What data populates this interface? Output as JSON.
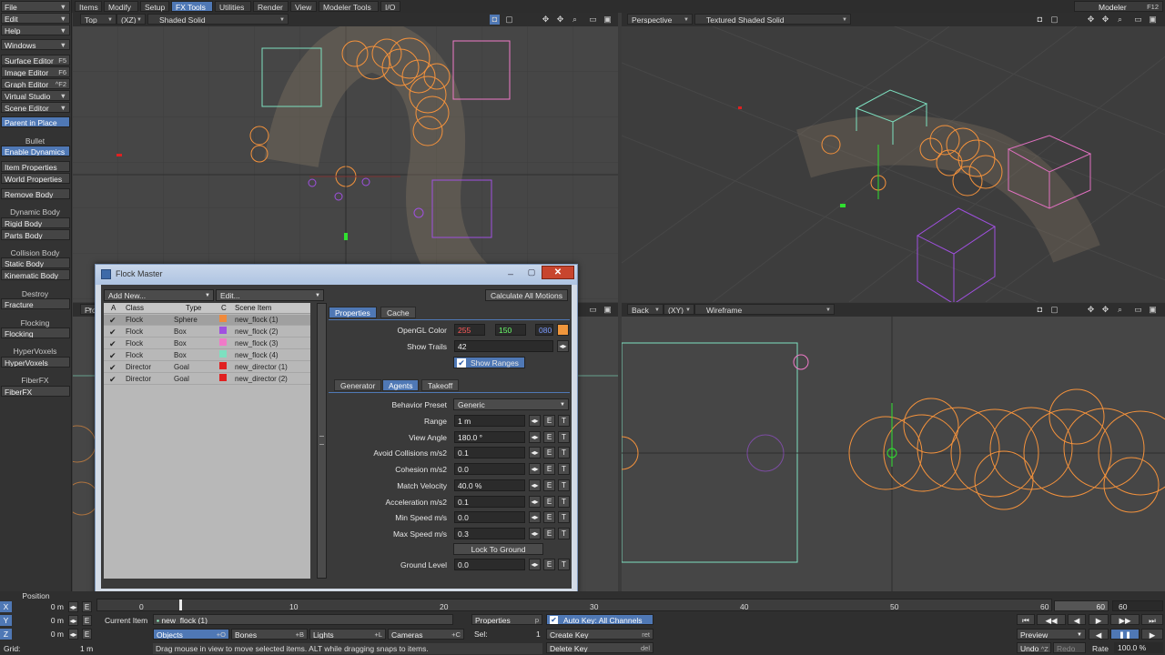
{
  "menu": {
    "left_dropdowns": [
      "File",
      "Edit",
      "Help"
    ],
    "tabs": [
      "Items",
      "Modify",
      "Setup",
      "FX Tools",
      "Utilities",
      "Render",
      "View",
      "Modeler Tools",
      "I/O"
    ],
    "active_tab": "FX Tools",
    "modeler": "Modeler",
    "modeler_key": "F12"
  },
  "sidebar": {
    "windows": "Windows",
    "editors": [
      {
        "label": "Surface Editor",
        "key": "F5"
      },
      {
        "label": "Image Editor",
        "key": "F6"
      },
      {
        "label": "Graph Editor",
        "key": "^F2"
      },
      {
        "label": "Virtual Studio",
        "key": ""
      },
      {
        "label": "Scene Editor",
        "key": ""
      }
    ],
    "parent_in_place": "Parent in Place",
    "bullet": "Bullet",
    "enable_dynamics": "Enable Dynamics",
    "item_properties": "Item Properties",
    "world_properties": "World Properties",
    "remove_body": "Remove Body",
    "dynamic_body": "Dynamic Body",
    "rigid_body": "Rigid Body",
    "parts_body": "Parts Body",
    "collision_body": "Collision Body",
    "static_body": "Static Body",
    "kinematic_body": "Kinematic Body",
    "destroy": "Destroy",
    "fracture": "Fracture",
    "flocking_head": "Flocking",
    "flocking": "Flocking",
    "hypervoxels_head": "HyperVoxels",
    "hypervoxels": "HyperVoxels",
    "fiberfx_head": "FiberFX",
    "fiberfx": "FiberFX",
    "position": "Position"
  },
  "viewports": {
    "top": {
      "view": "Top",
      "axis": "(XZ)",
      "mode": "Shaded Solid"
    },
    "persp": {
      "view": "Perspective",
      "mode": "Textured Shaded Solid"
    },
    "back": {
      "view": "Back",
      "axis": "(XY)",
      "mode": "Wireframe"
    },
    "front_stub": "Fro"
  },
  "dialog": {
    "title": "Flock Master",
    "add_new": "Add New...",
    "edit": "Edit...",
    "calculate": "Calculate All Motions",
    "columns": [
      "A",
      "Class",
      "Type",
      "C",
      "Scene Item"
    ],
    "rows": [
      {
        "cls": "Flock",
        "type": "Sphere",
        "color": "#f08a3c",
        "item": "new_flock (1)"
      },
      {
        "cls": "Flock",
        "type": "Box",
        "color": "#a050e0",
        "item": "new_flock (2)"
      },
      {
        "cls": "Flock",
        "type": "Box",
        "color": "#f07ac8",
        "item": "new_flock (3)"
      },
      {
        "cls": "Flock",
        "type": "Box",
        "color": "#7de0c0",
        "item": "new_flock (4)"
      },
      {
        "cls": "Director",
        "type": "Goal",
        "color": "#e02020",
        "item": "new_director (1)"
      },
      {
        "cls": "Director",
        "type": "Goal",
        "color": "#e02020",
        "item": "new_director (2)"
      }
    ],
    "tabs_top": [
      "Properties",
      "Cache"
    ],
    "opengl_color_label": "OpenGL Color",
    "opengl_r": "255",
    "opengl_g": "150",
    "opengl_b": "080",
    "opengl_swatch": "#f0963c",
    "show_trails_label": "Show Trails",
    "show_trails": "42",
    "show_ranges": "Show Ranges",
    "tabs_sub": [
      "Generator",
      "Agents",
      "Takeoff"
    ],
    "behavior_preset_label": "Behavior Preset",
    "behavior_preset": "Generic",
    "fields": [
      {
        "label": "Range",
        "value": "1 m"
      },
      {
        "label": "View Angle",
        "value": "180.0 °"
      },
      {
        "label": "Avoid Collisions m/s2",
        "value": "0.1"
      },
      {
        "label": "Cohesion m/s2",
        "value": "0.0"
      },
      {
        "label": "Match Velocity",
        "value": "40.0 %"
      },
      {
        "label": "Acceleration m/s2",
        "value": "0.1"
      },
      {
        "label": "Min Speed m/s",
        "value": "0.0"
      },
      {
        "label": "Max Speed m/s",
        "value": "0.3"
      }
    ],
    "lock_to_ground": "Lock To Ground",
    "ground_level_label": "Ground Level",
    "ground_level": "0.0",
    "e": "E",
    "t": "T"
  },
  "bottom": {
    "axes": [
      {
        "axis": "X",
        "value": "0 m"
      },
      {
        "axis": "Y",
        "value": "0 m"
      },
      {
        "axis": "Z",
        "value": "0 m"
      }
    ],
    "grid_label": "Grid:",
    "grid_value": "1 m",
    "timeline_ticks": [
      "0",
      "10",
      "20",
      "30",
      "40",
      "50",
      "60"
    ],
    "end_frame": "60",
    "current_item_label": "Current Item",
    "current_item": "new_flock (1)",
    "properties": "Properties",
    "p": "p",
    "sel_label": "Sel:",
    "sel_value": "1",
    "filter": [
      {
        "label": "Objects",
        "key": "+O"
      },
      {
        "label": "Bones",
        "key": "+B"
      },
      {
        "label": "Lights",
        "key": "+L"
      },
      {
        "label": "Cameras",
        "key": "+C"
      }
    ],
    "status": "Drag mouse in view to move selected items. ALT while dragging snaps to items.",
    "auto_key": "Auto Key: All Channels",
    "create_key": "Create Key",
    "create_key_shortcut": "ret",
    "delete_key": "Delete Key",
    "delete_key_shortcut": "del",
    "preview": "Preview",
    "undo": "Undo",
    "undo_key": "^Z",
    "redo": "Redo",
    "rate_label": "Rate",
    "rate_value": "100.0 %"
  }
}
